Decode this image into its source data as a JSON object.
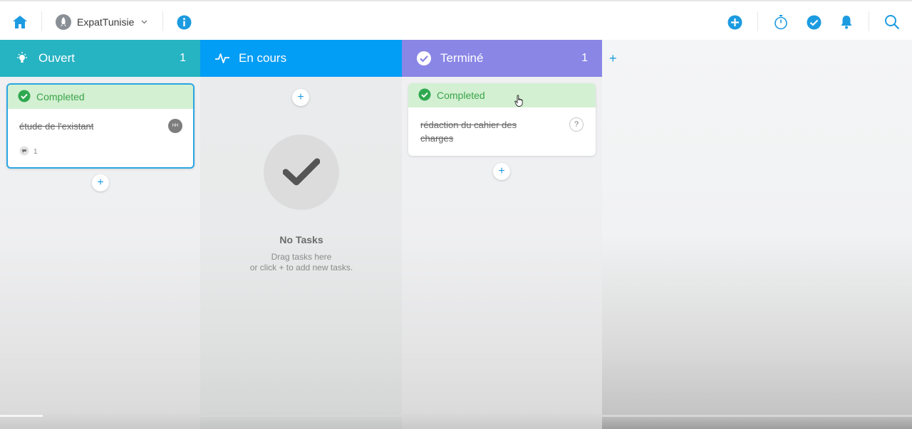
{
  "topbar": {
    "workspace_name": "ExpatTunisie",
    "icons": [
      "home-icon",
      "workspace-avatar-icon",
      "chevron-down-icon",
      "info-icon",
      "add-icon",
      "timer-icon",
      "checkmark-icon",
      "bell-icon",
      "search-icon"
    ]
  },
  "columns": [
    {
      "title": "Ouvert",
      "count": "1",
      "color": "#26b3c2",
      "icon": "lightbulb-icon"
    },
    {
      "title": "En cours",
      "count": "",
      "color": "#029df5",
      "icon": "activity-icon"
    },
    {
      "title": "Terminé",
      "count": "1",
      "color": "#8a86e6",
      "icon": "check-circle-icon"
    }
  ],
  "cards": [
    {
      "status": "Completed",
      "title": "étude de l'existant",
      "assignee_initials": "HH",
      "comment_count": "1"
    },
    {
      "status": "Completed",
      "title_line1": "rédaction du cahier des",
      "title_line2": "charges",
      "unassigned_mark": "?"
    }
  ],
  "empty_state": {
    "title": "No Tasks",
    "hint_line1": "Drag tasks here",
    "hint_line2": "or click + to add new tasks."
  },
  "add_task_label": "+",
  "add_column_label": "+",
  "progress": 0.047,
  "colors": {
    "accent": "#1d9be0",
    "completed_bg": "#d3f0d3",
    "completed_text": "#3aa348",
    "selected_border": "#2aa6e3"
  }
}
